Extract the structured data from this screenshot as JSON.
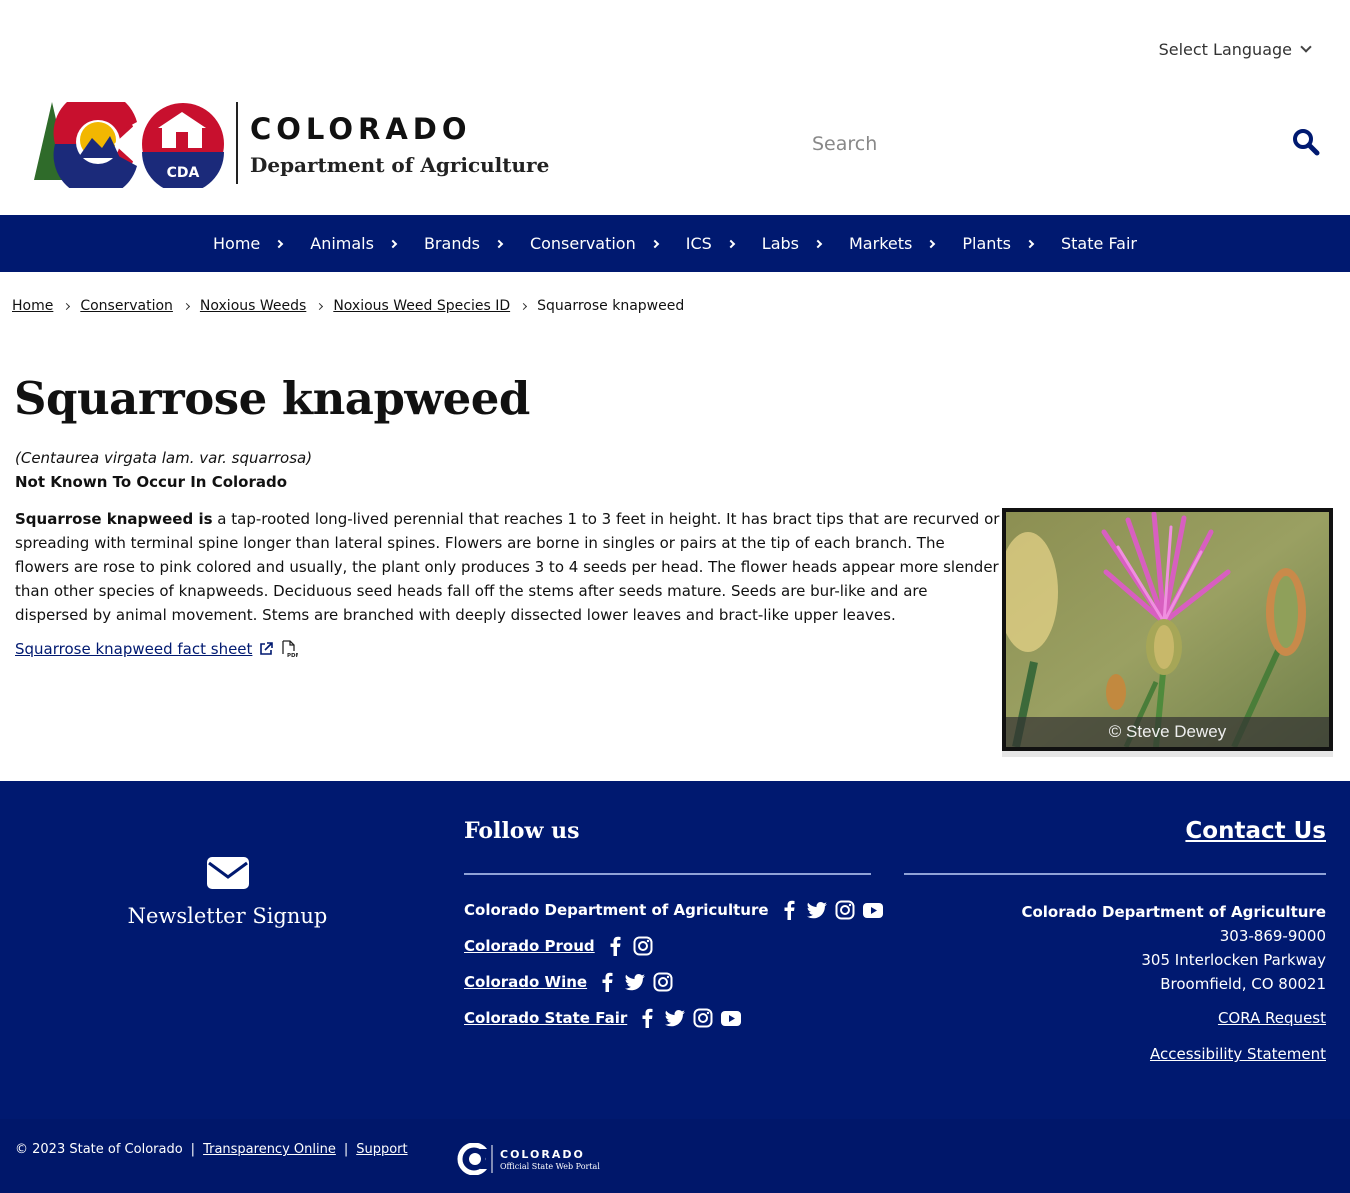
{
  "header": {
    "language_label": "Select Language",
    "logo_top": "COLORADO",
    "logo_bottom": "Department of Agriculture",
    "logo_badge": "CDA",
    "search_placeholder": "Search"
  },
  "nav": {
    "items": [
      {
        "label": "Home"
      },
      {
        "label": "Animals"
      },
      {
        "label": "Brands"
      },
      {
        "label": "Conservation"
      },
      {
        "label": "ICS"
      },
      {
        "label": "Labs"
      },
      {
        "label": "Markets"
      },
      {
        "label": "Plants"
      },
      {
        "label": "State Fair"
      }
    ]
  },
  "breadcrumb": {
    "items": [
      "Home",
      "Conservation",
      "Noxious Weeds",
      "Noxious Weed Species ID"
    ],
    "current": "Squarrose knapweed"
  },
  "main": {
    "title": "Squarrose knapweed",
    "scientific_name": "(Centaurea virgata lam. var. squarrosa)",
    "status": "Not Known To Occur In Colorado",
    "desc_lead": "Squarrose knapweed is",
    "desc_body": " a tap-rooted long-lived perennial that reaches 1 to 3 feet in height. It has bract tips that are recurved or spreading with terminal spine longer than lateral spines. Flowers are borne in singles or pairs at the tip of each branch. The flowers are rose to pink colored and usually, the plant only produces 3 to 4 seeds per head. The flower heads appear more slender than other species of knapweeds. Deciduous seed heads fall off the stems after seeds mature. Seeds are bur-like and are dispersed by animal movement. Stems are branched with deeply dissected lower leaves and bract-like upper leaves.",
    "fact_sheet_label": "Squarrose knapweed fact sheet",
    "photo_caption": "© Steve Dewey"
  },
  "footer": {
    "newsletter_label": "Newsletter Signup",
    "follow_title": "Follow us",
    "social": [
      {
        "label": "Colorado Department of Agriculture",
        "icons": [
          "facebook-icon",
          "twitter-icon",
          "instagram-icon",
          "youtube-icon"
        ]
      },
      {
        "label": "Colorado Proud",
        "icons": [
          "facebook-icon",
          "instagram-icon"
        ]
      },
      {
        "label": "Colorado Wine",
        "icons": [
          "facebook-icon",
          "twitter-icon",
          "instagram-icon"
        ]
      },
      {
        "label": "Colorado State Fair",
        "icons": [
          "facebook-icon",
          "twitter-icon",
          "instagram-icon",
          "youtube-icon"
        ]
      }
    ],
    "contact_title": "Contact Us",
    "contact_org": "Colorado Department of Agriculture",
    "contact_phone": "303-869-9000",
    "contact_street": "305 Interlocken Parkway",
    "contact_city": "Broomfield, CO 80021",
    "cora_label": "CORA Request",
    "accessibility_label": "Accessibility Statement",
    "copyright": "© 2023 State of Colorado",
    "sep": "|",
    "transparency_label": "Transparency Online",
    "support_label": "Support",
    "portal_title": "COLORADO",
    "portal_subtitle": "Official State Web Portal"
  },
  "colors": {
    "nav_bg": "#001970",
    "footer_bg": "#001970",
    "brand_red": "#c8102e",
    "brand_blue": "#1b2a7a",
    "brand_gold": "#f2b701"
  }
}
